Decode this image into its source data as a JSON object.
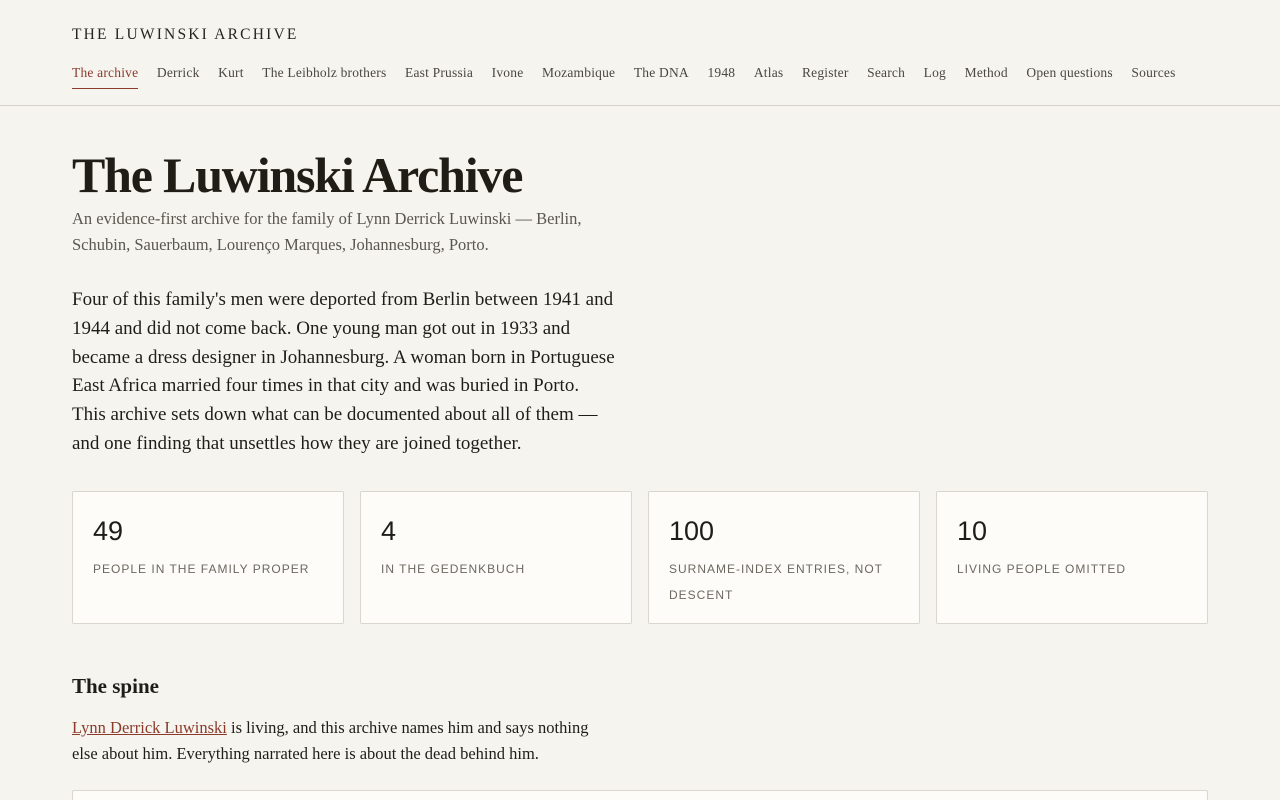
{
  "header": {
    "site_title": "THE LUWINSKI ARCHIVE",
    "nav": [
      "The archive",
      "Derrick",
      "Kurt",
      "The Leibholz brothers",
      "East Prussia",
      "Ivone",
      "Mozambique",
      "The DNA",
      "1948",
      "Atlas",
      "Register",
      "Search",
      "Log",
      "Method",
      "Open questions",
      "Sources"
    ],
    "active_nav": "The archive"
  },
  "main": {
    "title": "The Luwinski Archive",
    "subtitle": "An evidence-first archive for the family of Lynn Derrick Luwinski — Berlin, Schubin, Sauerbaum, Lourenço Marques, Johannesburg, Porto.",
    "lead": "Four of this family's men were deported from Berlin between 1941 and 1944 and did not come back. One young man got out in 1933 and became a dress designer in Johannesburg. A woman born in Portuguese East Africa married four times in that city and was buried in Porto. This archive sets down what can be documented about all of them — and one finding that unsettles how they are joined together.",
    "stats": [
      {
        "value": "49",
        "label": "PEOPLE IN THE FAMILY PROPER"
      },
      {
        "value": "4",
        "label": "IN THE GEDENKBUCH"
      },
      {
        "value": "100",
        "label": "SURNAME-INDEX ENTRIES, NOT DESCENT"
      },
      {
        "value": "10",
        "label": "LIVING PEOPLE OMITTED"
      }
    ],
    "spine": {
      "title": "The spine",
      "link_text": "Lynn Derrick Luwinski",
      "text": " is living, and this archive names him and says nothing else about him. Everything narrated here is about the dead behind him."
    }
  }
}
